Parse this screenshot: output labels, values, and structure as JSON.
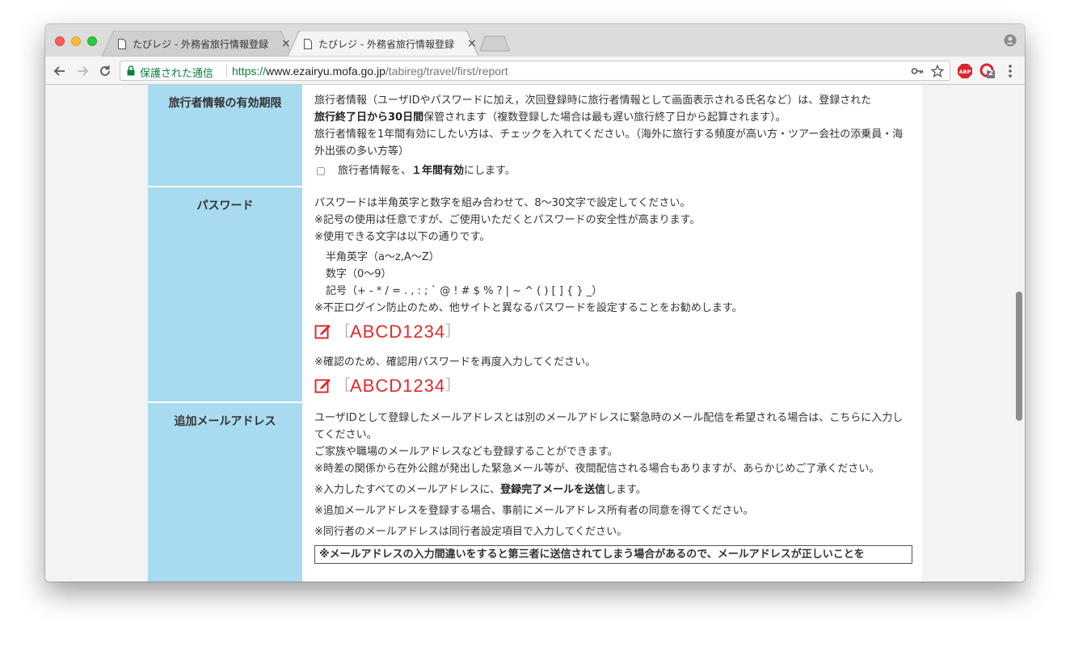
{
  "browser": {
    "tabs": [
      {
        "title": "たびレジ - 外務省旅行情報登録",
        "close": "×"
      },
      {
        "title": "たびレジ - 外務省旅行情報登録",
        "close": "×"
      }
    ],
    "omnibox": {
      "secure_label": "保護された通信",
      "url_scheme": "https://",
      "url_host": "www.ezairyu.mofa.go.jp",
      "url_path": "/tabireg/travel/first/report"
    },
    "extension_badge": "2"
  },
  "form": {
    "validity": {
      "label": "旅行者情報の有効期限",
      "line1": "旅行者情報（ユーザIDやパスワードに加え，次回登録時に旅行者情報として画面表示される氏名など）は、登録された",
      "line2_bold": "旅行終了日から30日間",
      "line2_rest": "保管されます（複数登録した場合は最も遅い旅行終了日から起算されます）。",
      "line3": "旅行者情報を1年間有効にしたい方は、チェックを入れてください。（海外に旅行する頻度が高い方・ツアー会社の添乗員・海外出張の多い方等）",
      "checkbox_pre": "旅行者情報を、",
      "checkbox_bold": "１年間有効",
      "checkbox_post": "にします。"
    },
    "password": {
      "label": "パスワード",
      "line1": "パスワードは半角英字と数字を組み合わせて、8〜30文字で設定してください。",
      "line2": "※記号の使用は任意ですが、ご使用いただくとパスワードの安全性が高まります。",
      "line3": "※使用できる文字は以下の通りです。",
      "chars_alpha": "半角英字（a〜z,A〜Z）",
      "chars_num": "数字（0〜9）",
      "chars_sym": "記号（+ - * / = . , : ; ` @ ! # $ % ? | ~ ^ ( ) [ ] { } _）",
      "line4": "※不正ログイン防止のため、他サイトと異なるパスワードを設定することをお勧めします。",
      "bracket_open": "［",
      "bracket_close": "］",
      "value": "ABCD1234",
      "confirm_note": "※確認のため、確認用パスワードを再度入力してください。",
      "confirm_value": "ABCD1234"
    },
    "email": {
      "label": "追加メールアドレス",
      "p1": "ユーザIDとして登録したメールアドレスとは別のメールアドレスに緊急時のメール配信を希望される場合は、こちらに入力してください。",
      "p2": "ご家族や職場のメールアドレスなども登録することができます。",
      "p3": "※時差の関係から在外公館が発出した緊急メール等が、夜間配信される場合もありますが、あらかじめご了承ください。",
      "p4_pre": "※入力したすべてのメールアドレスに、",
      "p4_bold": "登録完了メールを送信",
      "p4_post": "します。",
      "p5": "※追加メールアドレスを登録する場合、事前にメールアドレス所有者の同意を得てください。",
      "p6": "※同行者のメールアドレスは同行者設定項目で入力してください。",
      "warning": "※メールアドレスの入力間違いをすると第三者に送信されてしまう場合があるので、メールアドレスが正しいことを"
    }
  }
}
